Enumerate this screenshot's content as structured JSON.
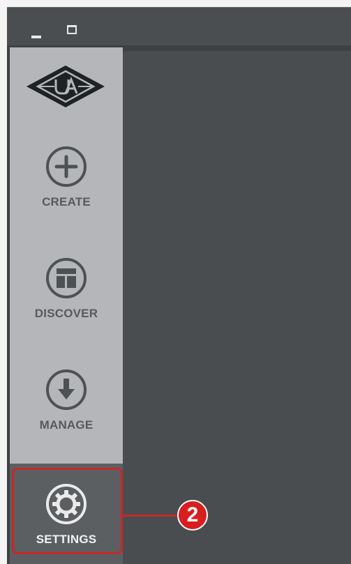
{
  "window": {
    "controls": {
      "minimize_icon": "minimize-icon",
      "maximize_icon": "maximize-icon"
    }
  },
  "sidebar": {
    "logo_icon": "ua-logo-icon",
    "items": [
      {
        "label": "CREATE",
        "icon": "plus-circle-icon"
      },
      {
        "label": "DISCOVER",
        "icon": "layout-circle-icon"
      },
      {
        "label": "MANAGE",
        "icon": "download-circle-icon"
      },
      {
        "label": "SETTINGS",
        "icon": "gear-icon"
      }
    ]
  },
  "annotation": {
    "callout_number": "2",
    "highlight_color": "#c62828"
  },
  "colors": {
    "titlebar": "#4b4e51",
    "sidebar": "#b4b6b9",
    "sidebar_selected": "#5c5f62",
    "content": "#4a4d50",
    "label_text": "#575a5d"
  }
}
